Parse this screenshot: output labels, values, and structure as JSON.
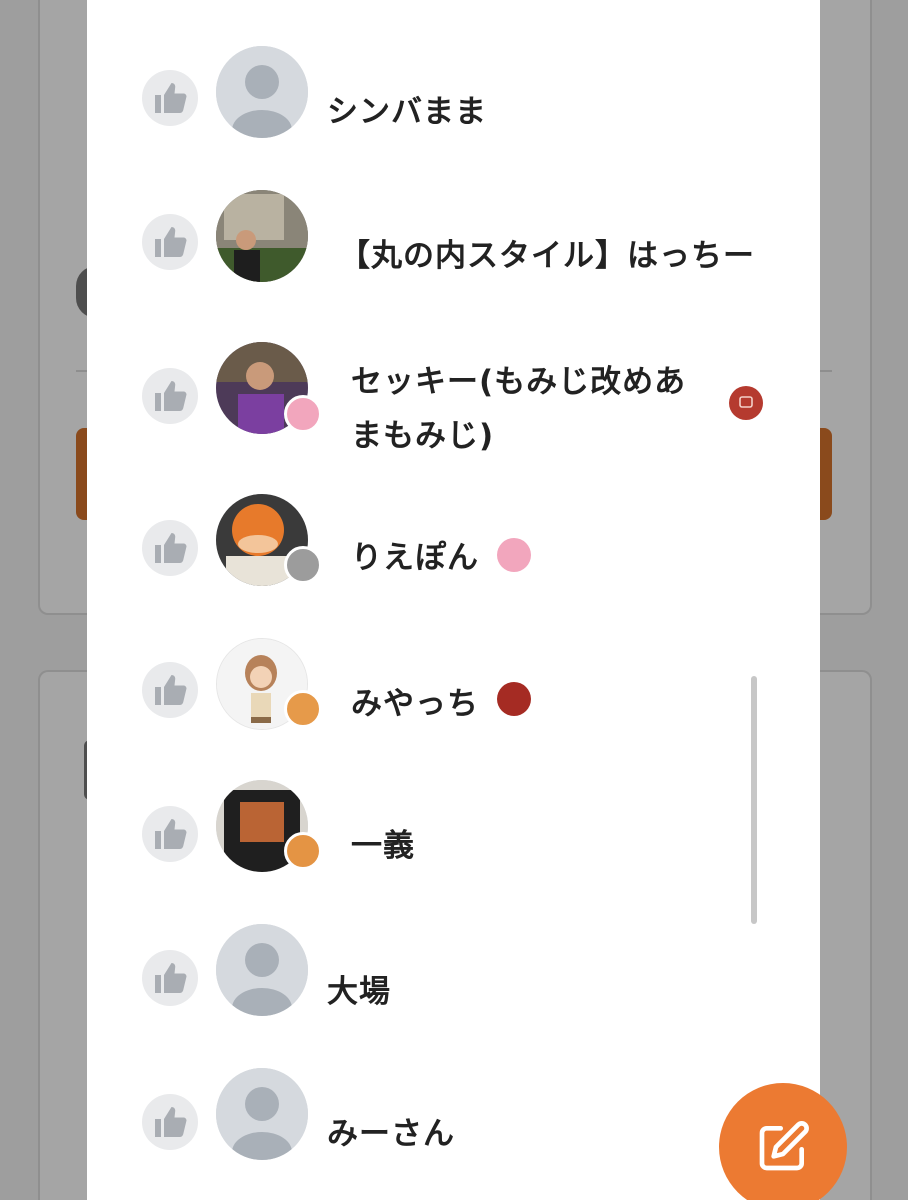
{
  "likers": [
    {
      "name": "シンバまま",
      "avatar": "default-avatar"
    },
    {
      "name": "【丸の内スタイル】はっちー",
      "avatar": "photo-avatar"
    },
    {
      "name_line1": "セッキー(もみじ改めあ",
      "name_line2": "まもみじ)",
      "avatar": "photo-avatar",
      "badge": "pink-rank-badge",
      "inline_badge": "red-review-badge"
    },
    {
      "name": "りえぽん",
      "avatar": "photo-avatar",
      "badge": "silver-elite-badge",
      "inline_badge": "pink-badge"
    },
    {
      "name": "みやっち",
      "avatar": "illustration-avatar",
      "badge": "orange-master-badge",
      "inline_badge": "red-like-badge"
    },
    {
      "name": "一義",
      "avatar": "photo-avatar",
      "badge": "orange-food-badge"
    },
    {
      "name": "大場",
      "avatar": "default-avatar"
    },
    {
      "name": "みーさん",
      "avatar": "default-avatar"
    }
  ],
  "icons": {
    "like": "thumbs-up-icon",
    "fab": "edit-icon"
  },
  "colors": {
    "accent": "#ec7a32",
    "overlay": "#9e9e9e",
    "like_bg": "#e9eaec",
    "like_icon": "#a9adb3"
  }
}
